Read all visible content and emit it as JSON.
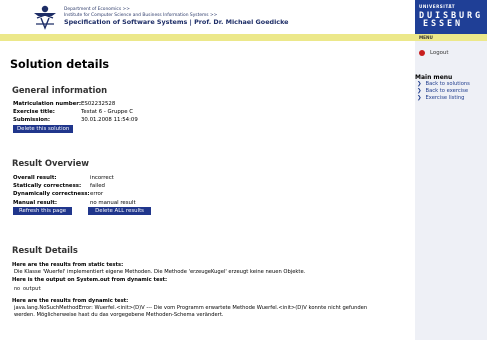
{
  "header": {
    "crumb1": "Department of Economics >>",
    "crumb2": "Institute for Computer Science and Business Information Systems >>",
    "title": "Specification of Software Systems | Prof. Dr. Michael Goedicke"
  },
  "sidebar": {
    "uni_label": "UNIVERSITÄT",
    "uni_logo_letters": [
      "D",
      "U",
      "I",
      "S",
      "B",
      "U",
      "R",
      "G",
      "E",
      "S",
      "S",
      "E",
      "N"
    ],
    "menu_tag": "MENU",
    "logout": "Logout",
    "main_menu_title": "Main menu",
    "items": [
      {
        "label": "Back to solutions"
      },
      {
        "label": "Back to exercise"
      },
      {
        "label": "Exercise listing"
      }
    ]
  },
  "page": {
    "title": "Solution details",
    "general": {
      "heading": "General information",
      "rows": [
        {
          "label": "Matriculation number:",
          "value": "ES02232528"
        },
        {
          "label": "Exercise title:",
          "value": "Testat 6 - Gruppe C"
        },
        {
          "label": "Submission:",
          "value": "30.01.2008 11:54:09"
        }
      ],
      "delete_button": "Delete this solution"
    },
    "overview": {
      "heading": "Result Overview",
      "rows": [
        {
          "label": "Overall result:",
          "value": "incorrect"
        },
        {
          "label": "Statically correctness:",
          "value": "failed"
        },
        {
          "label": "Dynamically correctness:",
          "value": "error"
        },
        {
          "label": "Manual result:",
          "value": "no manual result"
        }
      ],
      "refresh_button": "Refresh this page",
      "delete_all_button": "Delete ALL results"
    },
    "details": {
      "heading": "Result Details",
      "static_title": "Here are the results from static tests:",
      "static_text": "Die Klasse 'Wuerfel' implementiert eigene Methoden. Die Methode 'erzeugeKugel' erzeugt keine neuen Objekte.",
      "sysout_title": "Here is the output on System.out from dynamic test:",
      "sysout_text": "no output",
      "dynamic_title": "Here are the results from dynamic test:",
      "dynamic_text": "java.lang.NoSuchMethodError: Wuerfel.<init>(D)V --- Die vom Programm erwartete Methode Wuerfel.<init>(D)V konnte nicht gefunden werden. Möglicherweise hast du das vorgegebene Methoden-Schema verändert."
    }
  }
}
